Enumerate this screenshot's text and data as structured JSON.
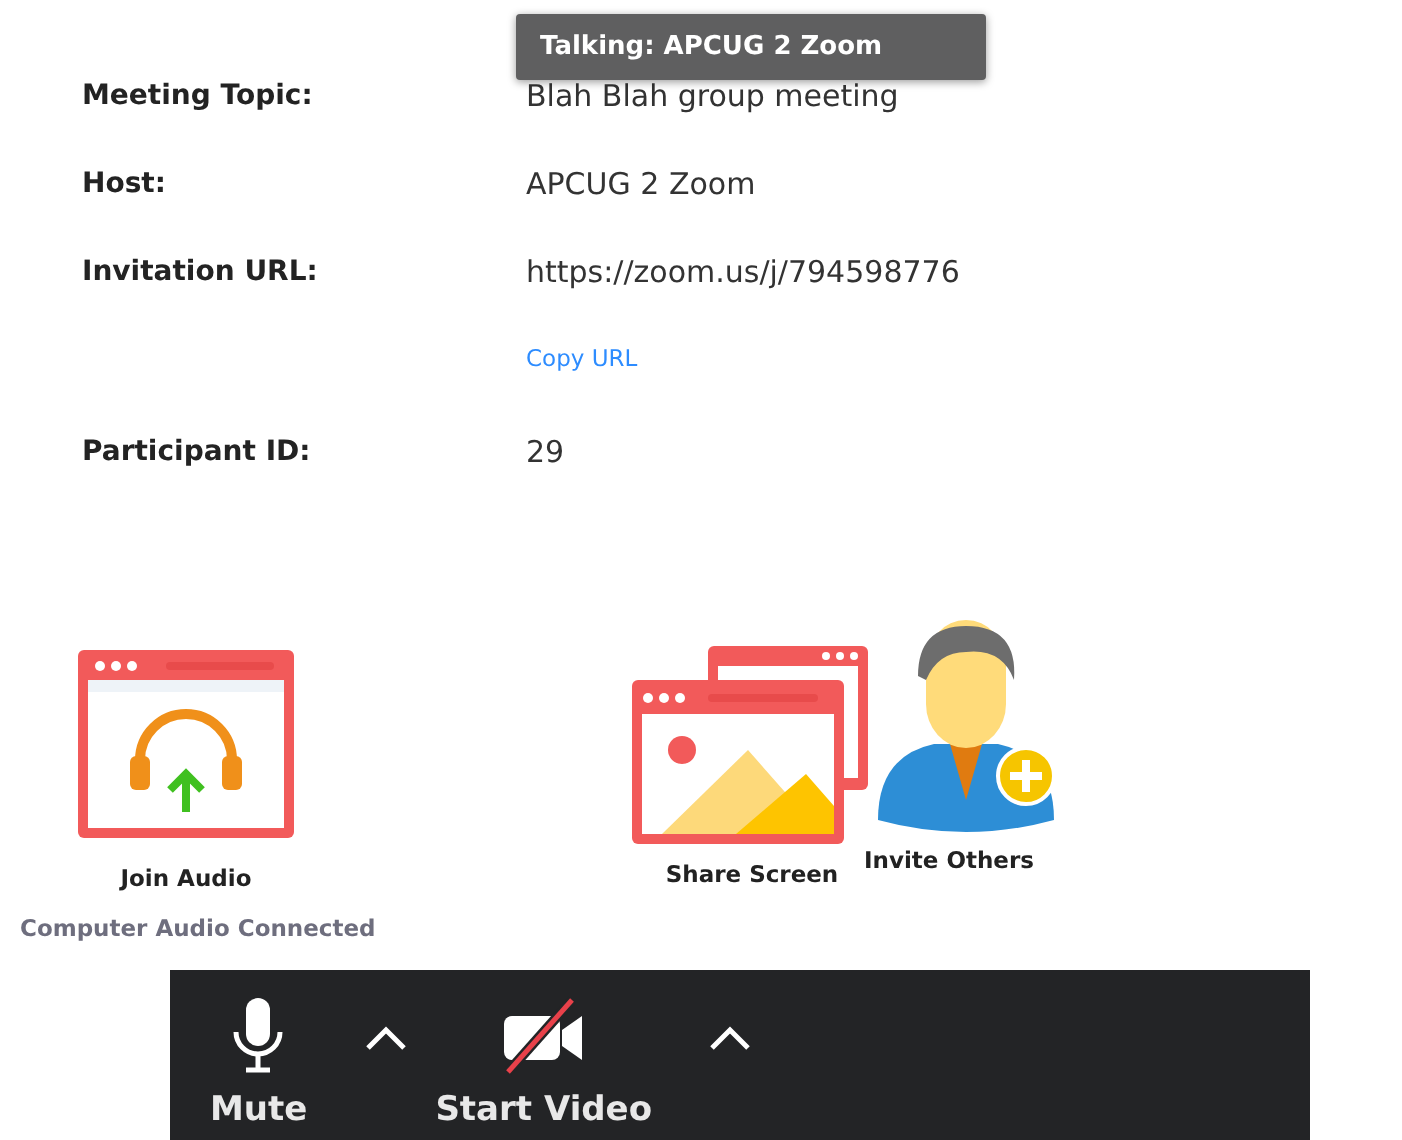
{
  "tooltip": {
    "text": "Talking: APCUG 2 Zoom"
  },
  "info": [
    {
      "label": "Meeting Topic:",
      "value": "Blah Blah group meeting"
    },
    {
      "label": "Host:",
      "value": "APCUG 2 Zoom"
    },
    {
      "label": "Invitation URL:",
      "value": "https://zoom.us/j/794598776",
      "link": "Copy URL"
    },
    {
      "label": "Participant ID:",
      "value": "29"
    }
  ],
  "actions": [
    {
      "kind": "audio",
      "label": "Join Audio"
    },
    {
      "kind": "share",
      "label": "Share Screen"
    },
    {
      "kind": "invite",
      "label": "Invite Others"
    }
  ],
  "audio_status": "Computer Audio Connected",
  "toolbar": [
    {
      "kind": "audio",
      "label": "Mute",
      "muted": false
    },
    {
      "kind": "video",
      "label": "Start Video",
      "on": false
    }
  ]
}
